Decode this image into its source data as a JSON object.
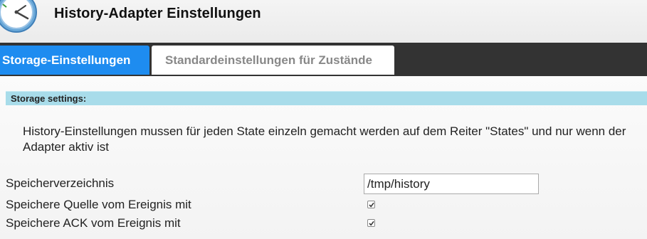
{
  "header": {
    "title": "History-Adapter Einstellungen",
    "logo_icon": "clock-icon"
  },
  "tabs": [
    {
      "label": "Storage-Einstellungen",
      "active": true
    },
    {
      "label": "Standardeinstellungen für Zustände",
      "active": false
    }
  ],
  "section": {
    "title": "Storage settings:",
    "info": "History-Einstellungen mussen für jeden State einzeln gemacht werden auf dem Reiter \"States\" und nur wenn der Adapter aktiv ist"
  },
  "form": {
    "storage_dir": {
      "label": "Speicherverzeichnis",
      "value": "/tmp/history"
    },
    "store_source": {
      "label": "Speichere Quelle vom Ereignis mit",
      "checked": true
    },
    "store_ack": {
      "label": "Speichere ACK vom Ereignis mit",
      "checked": true
    }
  },
  "colors": {
    "active_tab": "#1e8cf0",
    "tab_bar": "#333333",
    "section_bar": "#a8dcea"
  }
}
